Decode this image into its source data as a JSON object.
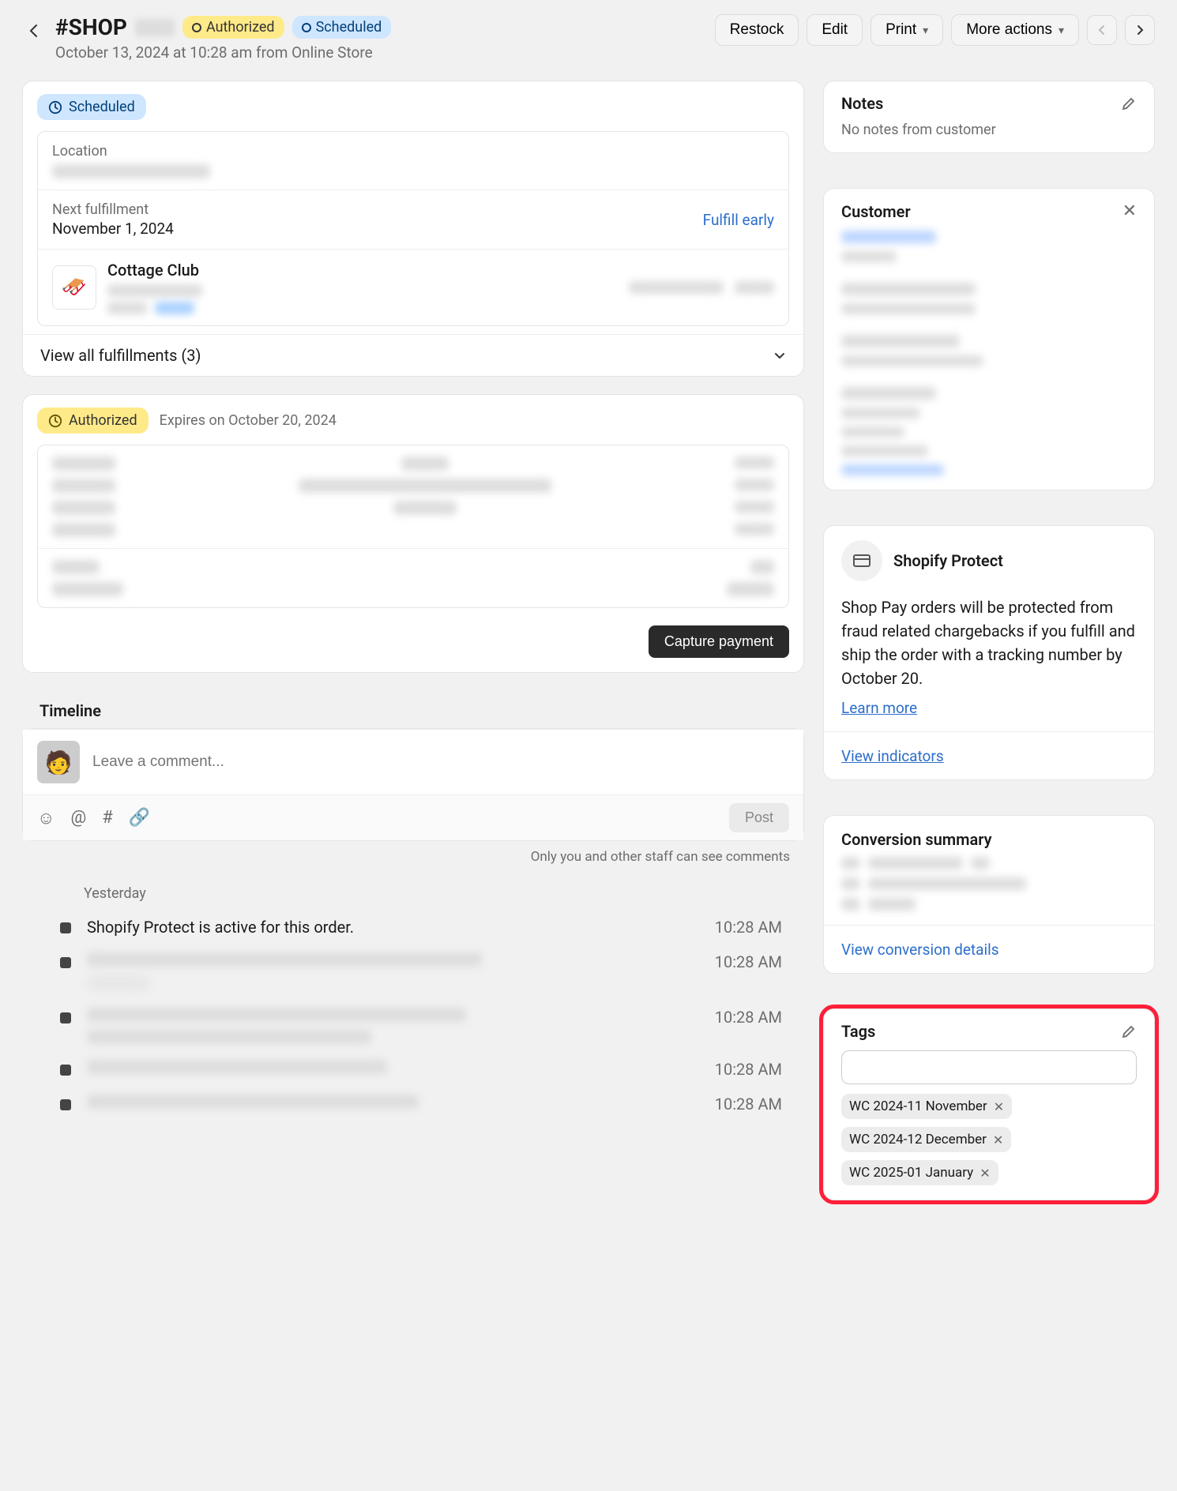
{
  "header": {
    "title": "#SHOP",
    "badge_authorized": "Authorized",
    "badge_scheduled": "Scheduled",
    "subtitle": "October 13, 2024 at 10:28 am from Online Store",
    "actions": {
      "restock": "Restock",
      "edit": "Edit",
      "print": "Print",
      "more": "More actions"
    }
  },
  "fulfillment": {
    "status": "Scheduled",
    "location_label": "Location",
    "next_label": "Next fulfillment",
    "next_value": "November 1, 2024",
    "fulfill_early": "Fulfill early",
    "product_name": "Cottage Club",
    "expand": "View all fulfillments (3)"
  },
  "payment": {
    "status": "Authorized",
    "expires": "Expires on October 20, 2024",
    "capture": "Capture payment"
  },
  "timeline": {
    "title": "Timeline",
    "placeholder": "Leave a comment...",
    "post": "Post",
    "note": "Only you and other staff can see comments",
    "day": "Yesterday",
    "items": [
      {
        "text": "Shopify Protect is active for this order.",
        "time": "10:28 AM",
        "blurred": false
      },
      {
        "text": "",
        "time": "10:28 AM",
        "blurred": true
      },
      {
        "text": "",
        "time": "10:28 AM",
        "blurred": true
      },
      {
        "text": "",
        "time": "10:28 AM",
        "blurred": true
      },
      {
        "text": "",
        "time": "10:28 AM",
        "blurred": true
      }
    ]
  },
  "notes": {
    "title": "Notes",
    "empty": "No notes from customer"
  },
  "customer": {
    "title": "Customer"
  },
  "protect": {
    "title": "Shopify Protect",
    "body": "Shop Pay orders will be protected from fraud related chargebacks if you fulfill and ship the order with a tracking number by October 20.",
    "learn_more": "Learn more",
    "view_indicators": "View indicators"
  },
  "conversion": {
    "title": "Conversion summary",
    "view": "View conversion details"
  },
  "tags": {
    "title": "Tags",
    "chips": [
      "WC 2024-11 November",
      "WC 2024-12 December",
      "WC 2025-01 January"
    ]
  }
}
